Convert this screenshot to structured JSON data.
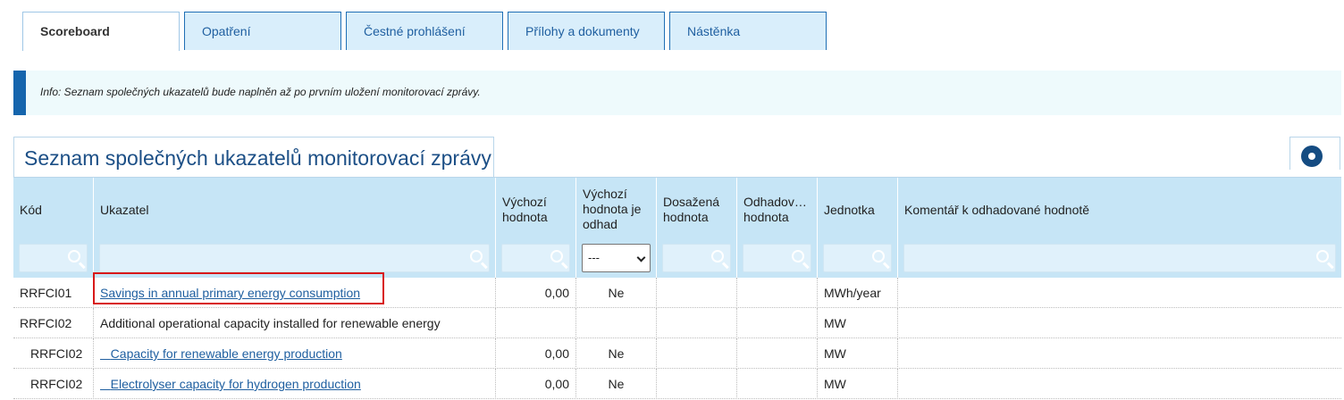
{
  "tabs": [
    {
      "label": "Scoreboard",
      "active": true
    },
    {
      "label": "Opatření",
      "active": false
    },
    {
      "label": "Čestné prohlášení",
      "active": false
    },
    {
      "label": "Přílohy a dokumenty",
      "active": false
    },
    {
      "label": "Nástěnka",
      "active": false
    }
  ],
  "info": {
    "text": "Info: Seznam společných ukazatelů bude naplněn až po prvním uložení monitorovací zprávy."
  },
  "grid": {
    "title": "Seznam společných ukazatelů monitorovací zprávy",
    "settings_icon": "gear-icon",
    "columns": [
      "Kód",
      "Ukazatel",
      "Výchozí\nhodnota",
      "Výchozí\nhodnota je\nodhad",
      "Dosažená\nhodnota",
      "Odhadov…\nhodnota",
      "Jednotka",
      "Komentář k odhadované hodnotě"
    ],
    "filter_select_value": "---",
    "rows": [
      {
        "kod": "RRFCI01",
        "ukazatel": "Savings in annual primary energy consumption",
        "vychozi": "0,00",
        "odhad": "Ne",
        "dosazena": "",
        "odhadovana": "",
        "jednotka": "MWh/year",
        "komentar": ""
      },
      {
        "kod": "RRFCI02",
        "ukazatel": "Additional operational capacity installed for renewable energy",
        "vychozi": "",
        "odhad": "",
        "dosazena": "",
        "odhadovana": "",
        "jednotka": "MW",
        "komentar": ""
      },
      {
        "kod": "RRFCI02",
        "ukazatel": "Capacity for renewable energy production",
        "vychozi": "0,00",
        "odhad": "Ne",
        "dosazena": "",
        "odhadovana": "",
        "jednotka": "MW",
        "komentar": ""
      },
      {
        "kod": "RRFCI02",
        "ukazatel": "Electrolyser capacity for hydrogen production",
        "vychozi": "0,00",
        "odhad": "Ne",
        "dosazena": "",
        "odhadovana": "",
        "jednotka": "MW",
        "komentar": ""
      }
    ]
  }
}
